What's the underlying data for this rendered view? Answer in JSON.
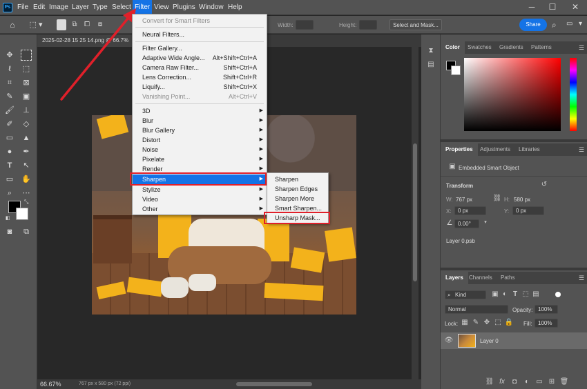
{
  "menubar": {
    "logo": "Ps",
    "items": [
      "File",
      "Edit",
      "Image",
      "Layer",
      "Type",
      "Select",
      "Filter",
      "View",
      "Plugins",
      "Window",
      "Help"
    ],
    "active": "Filter",
    "window_controls": [
      "minimize-icon",
      "maximize-icon",
      "close-icon"
    ]
  },
  "optionsbar": {
    "width_label": "Width:",
    "height_label": "Height:",
    "select_mask_label": "Select and Mask...",
    "share_label": "Share"
  },
  "document": {
    "tab_title": "2025-02-28 15 25 14.png @ 66.7%",
    "zoom": "66.67%",
    "doc_info": "767 px x 580 px (72 ppi)"
  },
  "filter_menu": {
    "items": [
      {
        "label": "Convert for Smart Filters",
        "shortcut": "",
        "disabled": true,
        "submenu": false
      },
      {
        "label": "Neural Filters...",
        "shortcut": "",
        "disabled": false,
        "submenu": false
      },
      {
        "label": "Filter Gallery...",
        "shortcut": "",
        "disabled": false,
        "submenu": false
      },
      {
        "label": "Adaptive Wide Angle...",
        "shortcut": "Alt+Shift+Ctrl+A",
        "disabled": false,
        "submenu": false
      },
      {
        "label": "Camera Raw Filter...",
        "shortcut": "Shift+Ctrl+A",
        "disabled": false,
        "submenu": false
      },
      {
        "label": "Lens Correction...",
        "shortcut": "Shift+Ctrl+R",
        "disabled": false,
        "submenu": false
      },
      {
        "label": "Liquify...",
        "shortcut": "Shift+Ctrl+X",
        "disabled": false,
        "submenu": false
      },
      {
        "label": "Vanishing Point...",
        "shortcut": "Alt+Ctrl+V",
        "disabled": true,
        "submenu": false
      },
      {
        "label": "3D",
        "shortcut": "",
        "disabled": false,
        "submenu": true
      },
      {
        "label": "Blur",
        "shortcut": "",
        "disabled": false,
        "submenu": true
      },
      {
        "label": "Blur Gallery",
        "shortcut": "",
        "disabled": false,
        "submenu": true
      },
      {
        "label": "Distort",
        "shortcut": "",
        "disabled": false,
        "submenu": true
      },
      {
        "label": "Noise",
        "shortcut": "",
        "disabled": false,
        "submenu": true
      },
      {
        "label": "Pixelate",
        "shortcut": "",
        "disabled": false,
        "submenu": true
      },
      {
        "label": "Render",
        "shortcut": "",
        "disabled": false,
        "submenu": true
      },
      {
        "label": "Sharpen",
        "shortcut": "",
        "disabled": false,
        "submenu": true,
        "highlighted": true
      },
      {
        "label": "Stylize",
        "shortcut": "",
        "disabled": false,
        "submenu": true
      },
      {
        "label": "Video",
        "shortcut": "",
        "disabled": false,
        "submenu": true
      },
      {
        "label": "Other",
        "shortcut": "",
        "disabled": false,
        "submenu": true
      }
    ]
  },
  "sharpen_submenu": {
    "items": [
      "Sharpen",
      "Sharpen Edges",
      "Sharpen More",
      "Smart Sharpen...",
      "Unsharp Mask..."
    ],
    "outlined": "Unsharp Mask..."
  },
  "color_panel": {
    "tabs": [
      "Color",
      "Swatches",
      "Gradients",
      "Patterns"
    ],
    "active": "Color",
    "hue_color": "#ff0000"
  },
  "properties_panel": {
    "tabs": [
      "Properties",
      "Adjustments",
      "Libraries"
    ],
    "active": "Properties",
    "object_type": "Embedded Smart Object",
    "section": "Transform",
    "w_label": "W:",
    "w_value": "767 px",
    "h_label": "H:",
    "h_value": "580 px",
    "x_label": "X:",
    "x_value": "0 px",
    "y_label": "Y:",
    "y_value": "0 px",
    "angle": "0.00°",
    "linked_file": "Layer 0.psb"
  },
  "layers_panel": {
    "tabs": [
      "Layers",
      "Channels",
      "Paths"
    ],
    "active": "Layers",
    "filter_kind": "Kind",
    "blend_mode": "Normal",
    "opacity_label": "Opacity:",
    "opacity_value": "100%",
    "lock_label": "Lock:",
    "fill_label": "Fill:",
    "fill_value": "100%",
    "layers": [
      {
        "name": "Layer 0"
      }
    ]
  },
  "colors": {
    "accent": "#1473e6",
    "highlight_box": "#e0202a",
    "annotation_arrow": "#e0202a"
  }
}
